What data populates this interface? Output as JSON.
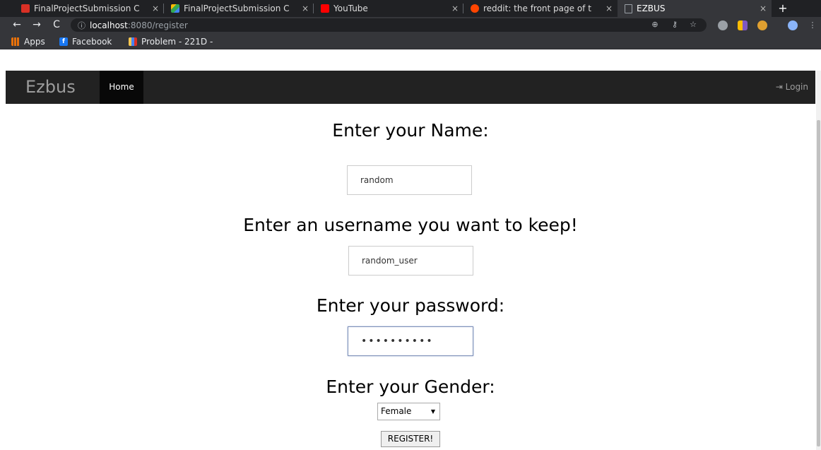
{
  "tabs": [
    {
      "title": "FinalProjectSubmission C",
      "icon": "gmail-icon"
    },
    {
      "title": "FinalProjectSubmission C",
      "icon": "google-drive-icon"
    },
    {
      "title": "YouTube",
      "icon": "youtube-icon"
    },
    {
      "title": "reddit: the front page of t",
      "icon": "reddit-icon"
    },
    {
      "title": "EZBUS",
      "icon": "page-icon"
    }
  ],
  "address": {
    "host": "localhost",
    "path": ":8080/register"
  },
  "bookmarks": [
    {
      "label": "Apps",
      "icon": "apps-icon"
    },
    {
      "label": "Facebook",
      "icon": "facebook-icon"
    },
    {
      "label": "Problem - 221D -",
      "icon": "codeforces-icon"
    }
  ],
  "navbar": {
    "brand": "Ezbus",
    "home": "Home",
    "login": "Login"
  },
  "form": {
    "name_heading": "Enter your Name:",
    "name_value": "random",
    "username_heading": "Enter an username you want to keep!",
    "username_value": "random_user",
    "password_heading": "Enter your password:",
    "password_value": "••••••••••",
    "gender_heading": "Enter your Gender:",
    "gender_value": "Female",
    "register_label": "REGISTER!"
  }
}
